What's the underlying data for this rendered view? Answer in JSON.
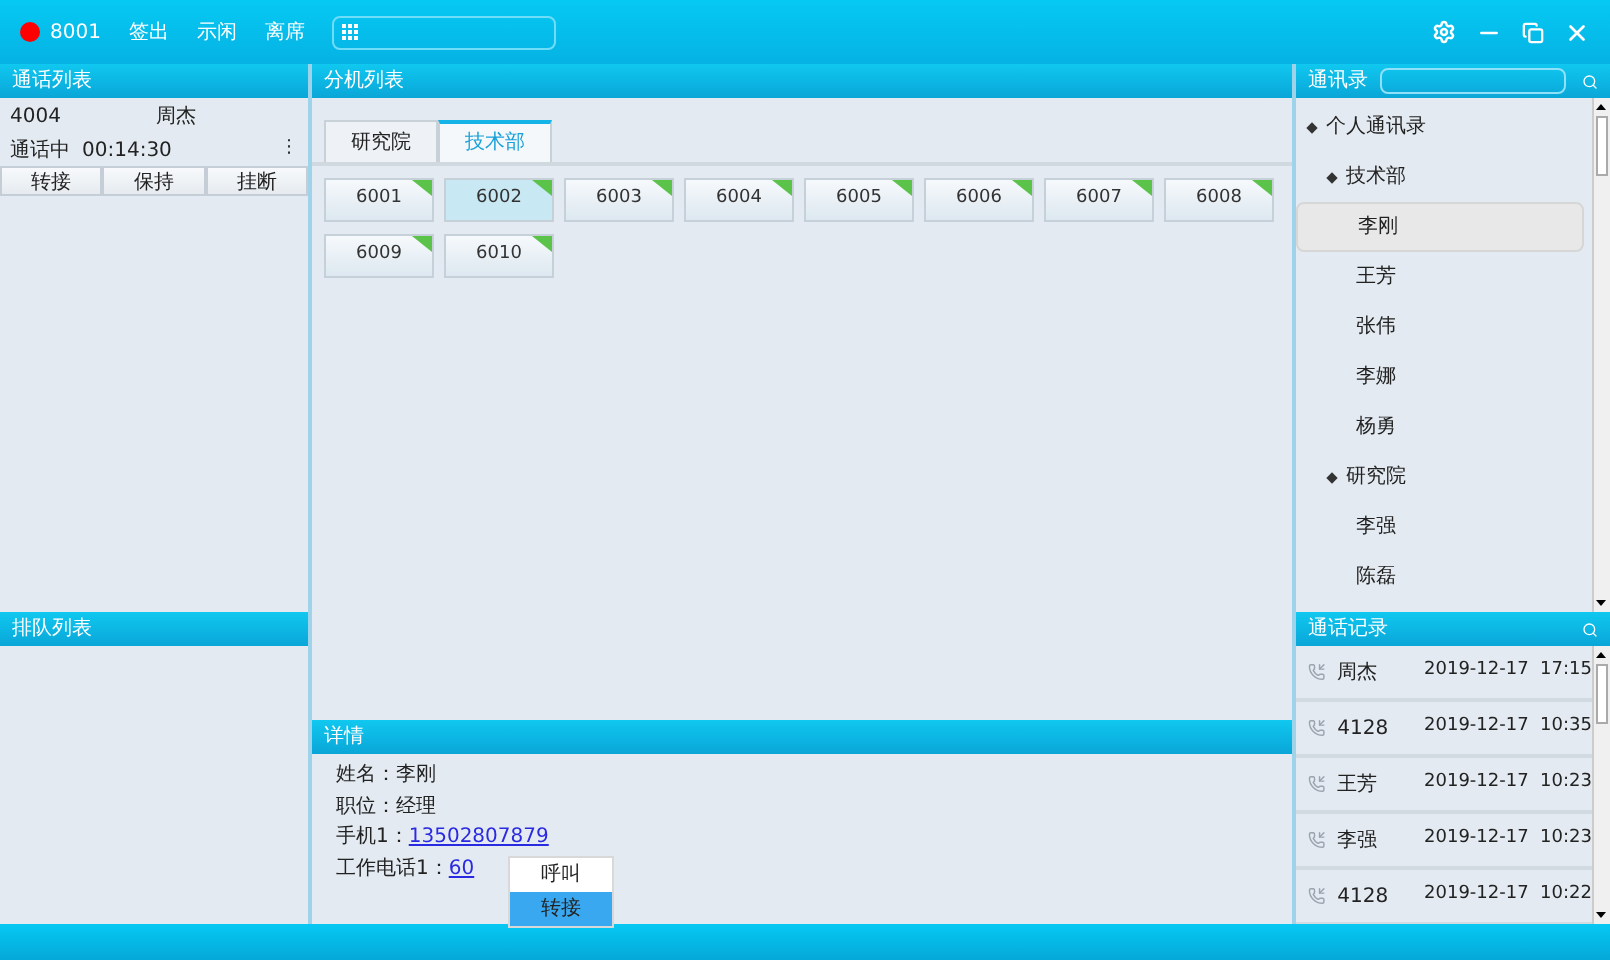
{
  "top_bar": {
    "status_on": true,
    "extension": "8001",
    "actions": [
      "签出",
      "示闲",
      "离席"
    ]
  },
  "call_list": {
    "title": "通话列表",
    "call": {
      "number": "4004",
      "name": "周杰",
      "status": "通话中",
      "duration": "00:14:30",
      "menu": "⋮"
    },
    "buttons": [
      "转接",
      "保持",
      "挂断"
    ]
  },
  "queue_list": {
    "title": "排队列表"
  },
  "extension_list": {
    "title": "分机列表",
    "tabs": [
      {
        "label": "研究院",
        "selected": false
      },
      {
        "label": "技术部",
        "selected": true
      }
    ],
    "extensions": [
      {
        "number": "6001",
        "selected": false
      },
      {
        "number": "6002",
        "selected": true
      },
      {
        "number": "6003",
        "selected": false
      },
      {
        "number": "6004",
        "selected": false
      },
      {
        "number": "6005",
        "selected": false
      },
      {
        "number": "6006",
        "selected": false
      },
      {
        "number": "6007",
        "selected": false
      },
      {
        "number": "6008",
        "selected": false
      },
      {
        "number": "6009",
        "selected": false
      },
      {
        "number": "6010",
        "selected": false
      }
    ]
  },
  "details": {
    "title": "详情",
    "fields": [
      {
        "label": "姓名：",
        "value": "李刚",
        "kind": "text"
      },
      {
        "label": "职位：",
        "value": "经理",
        "kind": "text"
      },
      {
        "label": "手机1：",
        "value": "13502807879",
        "kind": "link"
      },
      {
        "label": "工作电话1：",
        "value": "60",
        "kind": "link"
      }
    ],
    "context_menu": [
      {
        "label": "呼叫",
        "selected": false
      },
      {
        "label": "转接",
        "selected": true
      }
    ]
  },
  "contacts": {
    "title": "通讯录",
    "tree": [
      {
        "label": "个人通讯录",
        "expanded": true,
        "selected": false,
        "children": [
          {
            "label": "技术部",
            "expanded": true,
            "selected": false,
            "children": [
              {
                "label": "李刚",
                "selected": true
              },
              {
                "label": "王芳",
                "selected": false
              },
              {
                "label": "张伟",
                "selected": false
              },
              {
                "label": "李娜",
                "selected": false
              },
              {
                "label": "杨勇",
                "selected": false
              }
            ]
          },
          {
            "label": "研究院",
            "expanded": true,
            "selected": false,
            "children": [
              {
                "label": "李强",
                "selected": false
              },
              {
                "label": "陈磊",
                "selected": false
              }
            ]
          }
        ]
      }
    ]
  },
  "call_log": {
    "title": "通话记录",
    "rows": [
      {
        "name": "周杰",
        "time": "2019-12-17  17:15"
      },
      {
        "name": "4128",
        "time": "2019-12-17  10:35"
      },
      {
        "name": "王芳",
        "time": "2019-12-17  10:23"
      },
      {
        "name": "李强",
        "time": "2019-12-17  10:23"
      },
      {
        "name": "4128",
        "time": "2019-12-17  10:22"
      }
    ]
  }
}
